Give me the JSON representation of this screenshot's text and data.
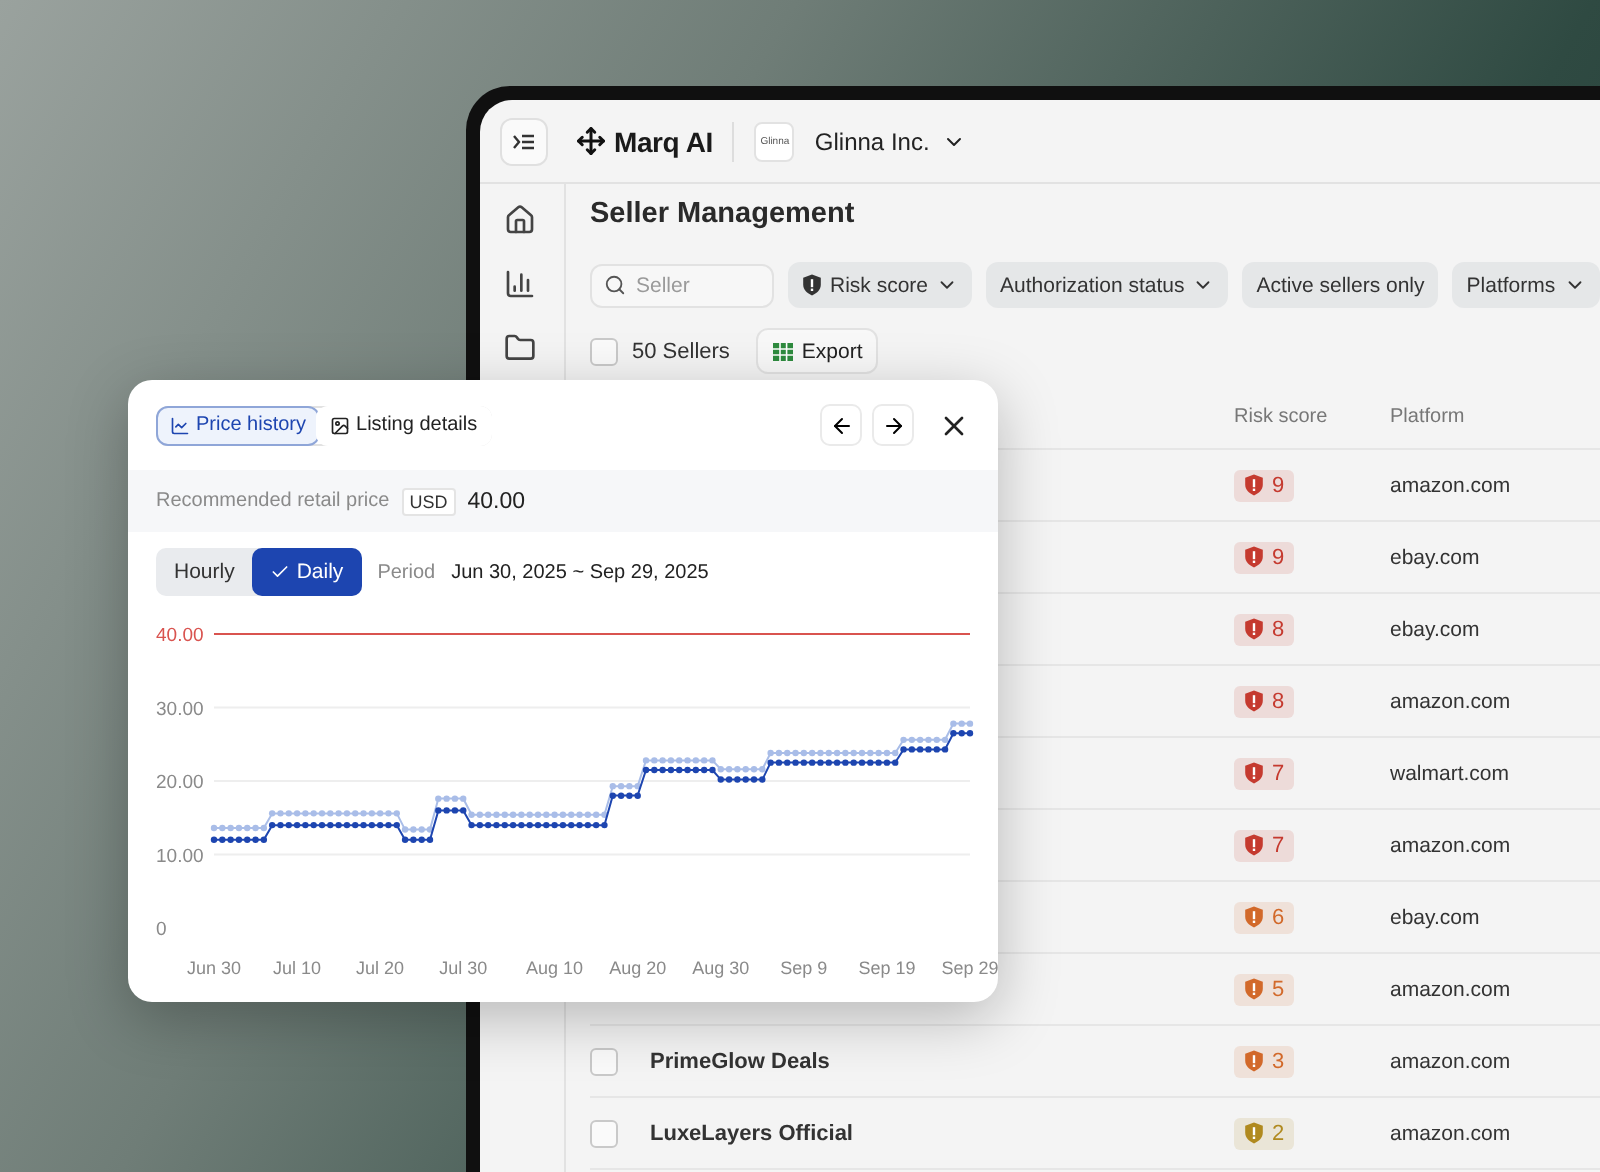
{
  "topbar": {
    "product": "Marq AI",
    "org_logo": "Glinna",
    "org": "Glinna Inc."
  },
  "page": {
    "title": "Seller Management",
    "search": {
      "placeholder": "Seller"
    },
    "filters": [
      {
        "label": "Risk score",
        "kind": "shield-dropdown"
      },
      {
        "label": "Authorization status",
        "kind": "dropdown"
      },
      {
        "label": "Active sellers only",
        "kind": "toggle"
      },
      {
        "label": "Platforms",
        "kind": "dropdown"
      }
    ],
    "select_all": {
      "checked": false
    },
    "count": "50 Sellers",
    "export": "Export",
    "columns": [
      "Risk score",
      "Platform"
    ],
    "rows": [
      {
        "risk": "9",
        "color": "#c53a2f",
        "platform": "amazon.com"
      },
      {
        "risk": "9",
        "color": "#c53a2f",
        "platform": "ebay.com"
      },
      {
        "risk": "8",
        "color": "#c53a2f",
        "platform": "ebay.com"
      },
      {
        "risk": "8",
        "color": "#c53a2f",
        "platform": "amazon.com"
      },
      {
        "risk": "7",
        "color": "#c53a2f",
        "platform": "walmart.com"
      },
      {
        "risk": "7",
        "color": "#c53a2f",
        "platform": "amazon.com"
      },
      {
        "risk": "6",
        "color": "#d2692a",
        "platform": "ebay.com"
      },
      {
        "risk": "5",
        "color": "#d2692a",
        "platform": "amazon.com"
      },
      {
        "checked": false,
        "seller": "PrimeGlow Deals",
        "risk": "3",
        "color": "#d2692a",
        "platform": "amazon.com"
      },
      {
        "checked": false,
        "seller": "LuxeLayers Official",
        "risk": "2",
        "color": "#b08a1f",
        "platform": "amazon.com"
      }
    ]
  },
  "popup": {
    "tabs": [
      {
        "label": "Price history",
        "kind": "chart",
        "selected": true
      },
      {
        "label": "Listing details",
        "kind": "image",
        "selected": false
      }
    ],
    "price_label": "Recommended retail price",
    "currency": "USD",
    "price": "40.00",
    "granularity": [
      {
        "label": "Hourly",
        "selected": false
      },
      {
        "label": "Daily",
        "selected": true
      }
    ],
    "period_label": "Period",
    "period": "Jun 30, 2025 ~ Sep 29, 2025",
    "chart_data": {
      "type": "line",
      "grid": true,
      "ylim": [
        0,
        40
      ],
      "categories": [
        "Jun 30",
        null,
        null,
        null,
        null,
        null,
        null,
        null,
        null,
        null,
        "Jul 10",
        null,
        null,
        null,
        null,
        null,
        null,
        null,
        null,
        null,
        "Jul 20",
        null,
        null,
        null,
        null,
        null,
        null,
        null,
        null,
        null,
        "Jul 30",
        null,
        null,
        null,
        null,
        null,
        null,
        null,
        null,
        null,
        null,
        "Aug 10",
        null,
        null,
        null,
        null,
        null,
        null,
        null,
        null,
        null,
        "Aug 20",
        null,
        null,
        null,
        null,
        null,
        null,
        null,
        null,
        null,
        "Aug 30",
        null,
        null,
        null,
        null,
        null,
        null,
        null,
        null,
        null,
        "Sep 9",
        null,
        null,
        null,
        null,
        null,
        null,
        null,
        null,
        null,
        "Sep 19",
        null,
        null,
        null,
        null,
        null,
        null,
        null,
        null,
        null,
        "Sep 29"
      ],
      "yticks": [
        {
          "value": 0,
          "label": "0"
        },
        {
          "value": 10,
          "label": "10.00"
        },
        {
          "value": 20,
          "label": "20.00"
        },
        {
          "value": 30,
          "label": "30.00"
        },
        {
          "value": 40,
          "label": "40.00"
        }
      ],
      "ref_lines": [
        {
          "axis": "y",
          "value": 40,
          "color": "#d9534f"
        }
      ],
      "series": [
        {
          "color": "#a9bde8",
          "marker": "circle",
          "values": [
            13.6,
            13.6,
            13.6,
            13.6,
            13.6,
            13.6,
            13.6,
            15.6,
            15.6,
            15.6,
            15.6,
            15.6,
            15.6,
            15.6,
            15.6,
            15.6,
            15.6,
            15.6,
            15.6,
            15.6,
            15.6,
            15.6,
            15.6,
            13.4,
            13.4,
            13.4,
            13.4,
            17.6,
            17.6,
            17.6,
            17.6,
            15.4,
            15.4,
            15.4,
            15.4,
            15.4,
            15.4,
            15.4,
            15.4,
            15.4,
            15.4,
            15.4,
            15.4,
            15.4,
            15.4,
            15.4,
            15.4,
            15.4,
            19.3,
            19.3,
            19.3,
            19.3,
            22.8,
            22.8,
            22.8,
            22.8,
            22.8,
            22.8,
            22.8,
            22.8,
            22.8,
            21.6,
            21.6,
            21.6,
            21.6,
            21.6,
            21.6,
            23.8,
            23.8,
            23.8,
            23.8,
            23.8,
            23.8,
            23.8,
            23.8,
            23.8,
            23.8,
            23.8,
            23.8,
            23.8,
            23.8,
            23.8,
            23.8,
            25.6,
            25.6,
            25.6,
            25.6,
            25.6,
            25.6,
            27.8,
            27.8,
            27.8
          ]
        },
        {
          "color": "#1d45b0",
          "marker": "circle",
          "values": [
            12,
            12,
            12,
            12,
            12,
            12,
            12,
            14,
            14,
            14,
            14,
            14,
            14,
            14,
            14,
            14,
            14,
            14,
            14,
            14,
            14,
            14,
            14,
            12,
            12,
            12,
            12,
            16,
            16,
            16,
            16,
            14,
            14,
            14,
            14,
            14,
            14,
            14,
            14,
            14,
            14,
            14,
            14,
            14,
            14,
            14,
            14,
            14,
            18,
            18,
            18,
            18,
            21.5,
            21.5,
            21.5,
            21.5,
            21.5,
            21.5,
            21.5,
            21.5,
            21.5,
            20.2,
            20.2,
            20.2,
            20.2,
            20.2,
            20.2,
            22.5,
            22.5,
            22.5,
            22.5,
            22.5,
            22.5,
            22.5,
            22.5,
            22.5,
            22.5,
            22.5,
            22.5,
            22.5,
            22.5,
            22.5,
            22.5,
            24.3,
            24.3,
            24.3,
            24.3,
            24.3,
            24.3,
            26.5,
            26.5,
            26.5
          ]
        }
      ]
    }
  }
}
